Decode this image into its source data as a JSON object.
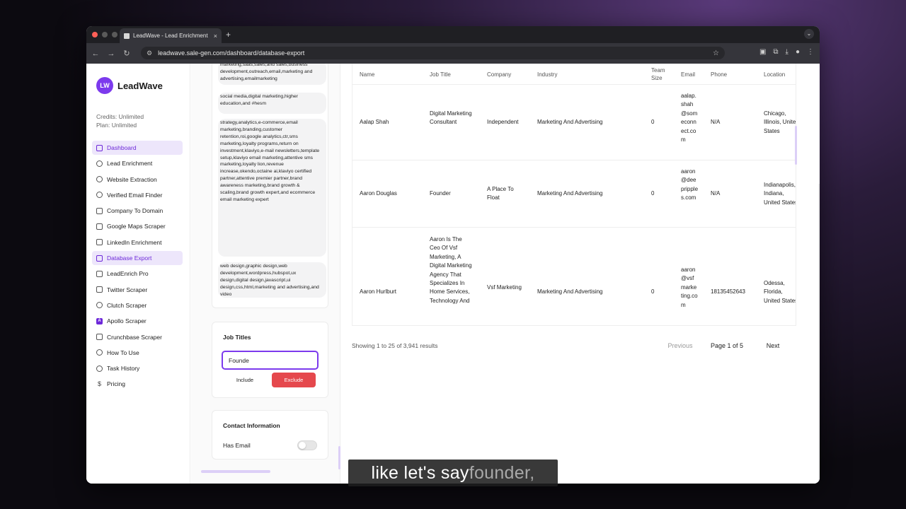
{
  "browser": {
    "tab_title": "LeadWave - Lead Enrichment",
    "tab_close": "×",
    "new_tab": "+",
    "url": "leadwave.sale-gen.com/dashboard/database-export"
  },
  "sidebar": {
    "logo_badge": "LW",
    "brand": "LeadWave",
    "credits": "Credits: Unlimited",
    "plan": "Plan: Unlimited",
    "items": [
      {
        "label": "Dashboard",
        "icon": "home-icon"
      },
      {
        "label": "Lead Enrichment",
        "icon": "users-icon"
      },
      {
        "label": "Website Extraction",
        "icon": "globe-icon"
      },
      {
        "label": "Verified Email Finder",
        "icon": "at-sign-icon"
      },
      {
        "label": "Company To Domain",
        "icon": "building-icon"
      },
      {
        "label": "Google Maps Scraper",
        "icon": "map-icon"
      },
      {
        "label": "LinkedIn Enrichment",
        "icon": "linkedin-icon"
      },
      {
        "label": "Database Export",
        "icon": "database-icon"
      },
      {
        "label": "LeadEnrich Pro",
        "icon": "database-icon"
      },
      {
        "label": "Twitter Scraper",
        "icon": "twitter-icon"
      },
      {
        "label": "Clutch Scraper",
        "icon": "search-icon"
      },
      {
        "label": "Apollo Scraper",
        "icon": "apollo-icon"
      },
      {
        "label": "Crunchbase Scraper",
        "icon": "database-icon"
      },
      {
        "label": "How To Use",
        "icon": "play-icon"
      },
      {
        "label": "Task History",
        "icon": "clock-icon"
      },
      {
        "label": "Pricing",
        "icon": "dollar-icon"
      }
    ]
  },
  "filters": {
    "tags": [
      "marketing,saas,sales,and sales,business development,outreach,email,marketing and advertising,emailmarketing",
      "social media,digital marketing,higher education,and #hesm",
      "strategy,analytics,e-commerce,email marketing,branding,customer retention,roi,google analytics,ctr,sms marketing,loyalty programs,return on investment,klaviyo,e-mail newsletters,template setup,klaviyo email marketing,attentive sms marketing,loyalty lion,revenue increase,okendo,octaine ai,klaviyo certified partner,attentive premier partner,brand awareness marketing,brand growth & scaling,brand growth expert,and ecommerce email marketing expert",
      "web design,graphic design,web development,wordpress,hubspot,ux design,digital design,javascript,ui design,css,html,marketing and advertising,and video"
    ],
    "job_titles_heading": "Job Titles",
    "job_titles_value": "Founde",
    "include_label": "Include",
    "exclude_label": "Exclude",
    "contact_heading": "Contact Information",
    "has_email_label": "Has Email"
  },
  "table": {
    "headers": [
      "Name",
      "Job Title",
      "Company",
      "Industry",
      "Team Size",
      "Email",
      "Phone",
      "Location"
    ],
    "rows": [
      {
        "name": "Aalap Shah",
        "job_title": "Digital Marketing Consultant",
        "company": "Independent",
        "industry": "Marketing And Advertising",
        "team_size": "0",
        "email": "aalap.shah@someconnect.com",
        "phone": "N/A",
        "location": "Chicago, Illinois, United States"
      },
      {
        "name": "Aaron Douglas",
        "job_title": "Founder",
        "company": "A Place To Float",
        "industry": "Marketing And Advertising",
        "team_size": "0",
        "email": "aaron@deepripples.com",
        "phone": "N/A",
        "location": "Indianapolis, Indiana, United States"
      },
      {
        "name": "Aaron Hurlburt",
        "job_title": "Aaron Is The Ceo Of Vsf Marketing, A Digital Marketing Agency That Specializes In Home Services, Technology And",
        "company": "Vsf Marketing",
        "industry": "Marketing And Advertising",
        "team_size": "0",
        "email": "aaron@vsfmarketing.com",
        "phone": "18135452643",
        "location": "Odessa, Florida, United States"
      }
    ]
  },
  "pagination": {
    "showing": "Showing 1 to 25 of 3,941 results",
    "previous": "Previous",
    "page_info": "Page 1 of 5",
    "next": "Next"
  },
  "caption": {
    "text": "like let's say ",
    "highlight": "founder,"
  },
  "colors": {
    "accent": "#7c3aed",
    "exclude": "#e5484d",
    "active_bg": "#ede6fb"
  }
}
